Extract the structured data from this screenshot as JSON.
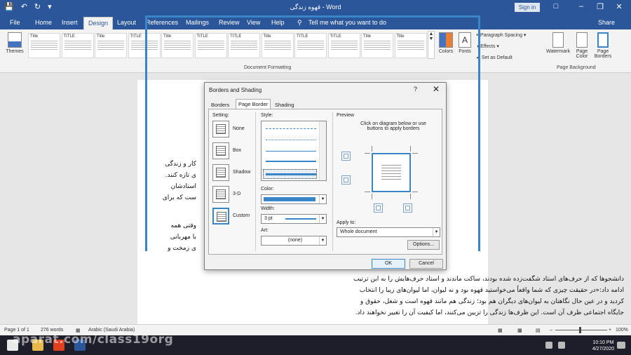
{
  "titlebar": {
    "title": "قهوه زندگی - Word",
    "sign_in": "Sign in"
  },
  "menu": {
    "file": "File",
    "home": "Home",
    "insert": "Insert",
    "design": "Design",
    "layout": "Layout",
    "references": "References",
    "mailings": "Mailings",
    "review": "Review",
    "view": "View",
    "help": "Help",
    "tell_me": "Tell me what you want to do",
    "share": "Share"
  },
  "ribbon": {
    "themes": "Themes",
    "style_names": [
      "Title",
      "TITLE",
      "Title",
      "TITLE",
      "Title",
      "TITLE",
      "TITLE",
      "Title",
      "TITLE",
      "TITLE",
      "Title",
      "Title"
    ],
    "colors": "Colors",
    "fonts": "Fonts",
    "paragraph_spacing": "Paragraph Spacing",
    "effects": "Effects",
    "set_default": "Set as Default",
    "document_formatting": "Document Formatting",
    "watermark": "Watermark",
    "page_color": "Page Color",
    "page_borders": "Page Borders",
    "page_background": "Page Background"
  },
  "document": {
    "lines": [
      "کار و زندگی",
      "ی تازه کنند.",
      "استادشان",
      "ست که برای",
      "وقتی همه",
      "با مهربانی",
      "ی زمخت و",
      "دانشجوها که از حرف‌های استاد شگفت‌زده شده بودند، ساکت ماندند و استاد حرف‌هایش را به این ترتیب",
      "ادامه داد:«در حقیقت چیزی که شما واقعاً می‌خواستید قهوه بود و نه لیوان، اما لیوان‌های زیبا را انتخاب",
      "کردید و در عین حال نگاهتان به لیوان‌های دیگران هم بود؛ زندگی هم مانند قهوه است و شغل، حقوق و",
      "جایگاه اجتماعی ظرف آن است. این ظرف‌ها زندگی را تزیین می‌کنند، اما کیفیت آن را تغییر نخواهند داد."
    ]
  },
  "dialog": {
    "title": "Borders and Shading",
    "help": "?",
    "close": "✕",
    "tabs": [
      "Borders",
      "Page Border",
      "Shading"
    ],
    "active_tab": "Page Border",
    "setting_label": "Setting:",
    "settings": [
      "None",
      "Box",
      "Shadow",
      "3-D",
      "Custom"
    ],
    "selected_setting": "Custom",
    "style_label": "Style:",
    "color_label": "Color:",
    "color_value": "#3a84c8",
    "width_label": "Width:",
    "width_value": "3 pt",
    "art_label": "Art:",
    "art_value": "(none)",
    "preview_label": "Preview",
    "preview_hint": "Click on diagram below or use buttons to apply borders",
    "apply_label": "Apply to:",
    "apply_value": "Whole document",
    "options": "Options...",
    "ok": "OK",
    "cancel": "Cancel"
  },
  "status": {
    "page": "Page 1 of 1",
    "words": "276 words",
    "language": "Arabic (Saudi Arabia)",
    "zoom": "100%"
  },
  "taskbar": {
    "time": "10:10 PM",
    "date": "4/27/2020"
  },
  "watermark": "aparat.com/class19org",
  "colors": {
    "brand": "#2b579a",
    "accent": "#3a84c8"
  }
}
